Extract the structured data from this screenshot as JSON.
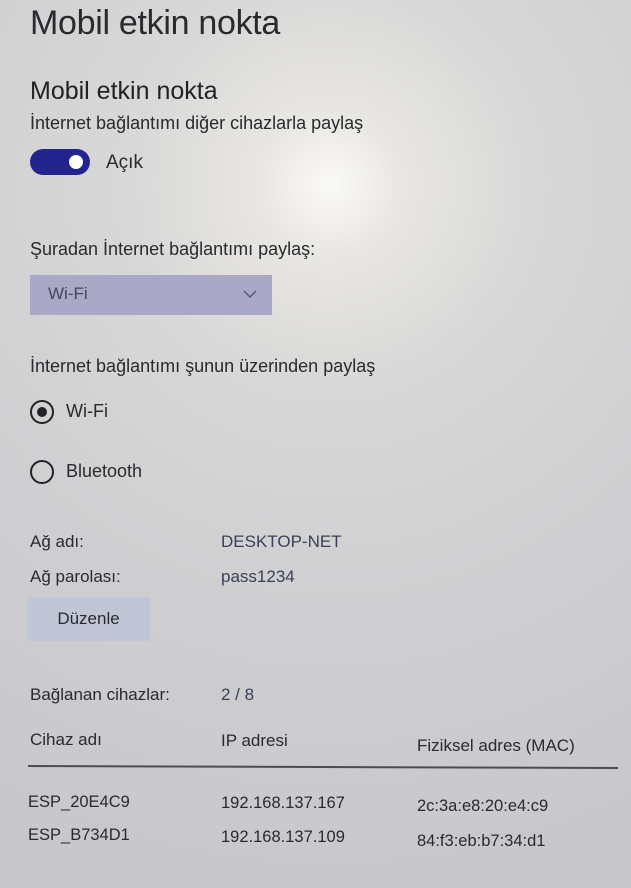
{
  "page": {
    "title": "Mobil etkin nokta"
  },
  "hotspot": {
    "section_title": "Mobil etkin nokta",
    "description": "İnternet bağlantımı diğer cihazlarla paylaş",
    "toggle_state": "Açık",
    "toggle_on": true,
    "accent_color": "#23258f"
  },
  "share_from": {
    "label": "Şuradan İnternet bağlantımı paylaş:",
    "selected": "Wi-Fi"
  },
  "share_over": {
    "label": "İnternet bağlantımı şunun üzerinden paylaş",
    "options": [
      {
        "label": "Wi-Fi",
        "selected": true
      },
      {
        "label": "Bluetooth",
        "selected": false
      }
    ]
  },
  "network": {
    "name_label": "Ağ adı:",
    "name_value": "DESKTOP-NET",
    "password_label": "Ağ parolası:",
    "password_value": "pass1234",
    "edit_label": "Düzenle"
  },
  "devices": {
    "connected_label": "Bağlanan cihazlar:",
    "connected_value": "2 / 8",
    "columns": [
      "Cihaz adı",
      "IP adresi",
      "Fiziksel adres (MAC)"
    ],
    "rows": [
      {
        "name": "ESP_20E4C9",
        "ip": "192.168.137.167",
        "mac": "2c:3a:e8:20:e4:c9"
      },
      {
        "name": "ESP_B734D1",
        "ip": "192.168.137.109",
        "mac": "84:f3:eb:b7:34:d1"
      }
    ]
  }
}
